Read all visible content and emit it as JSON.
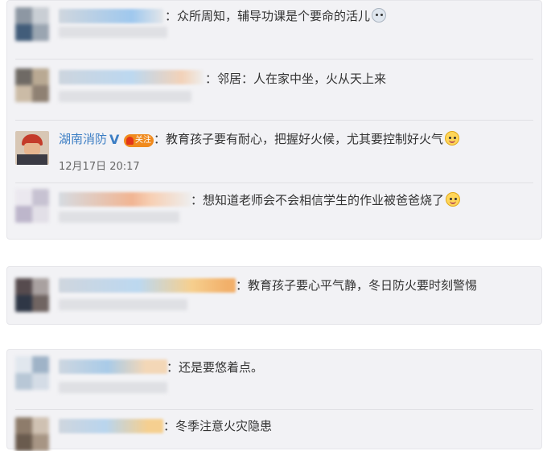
{
  "comments": [
    {
      "text": "：众所周知，辅导功课是个要命的活儿"
    },
    {
      "text": "：邻居：人在家中坐，火从天上来"
    },
    {
      "user": "湖南消防",
      "badge": "关注",
      "text": "：教育孩子要有耐心，把握好火候，尤其要控制好火气",
      "time": "12月17日 20:17"
    },
    {
      "text": "：想知道老师会不会相信学生的作业被爸爸烧了"
    },
    {
      "text": "：教育孩子要心平气静，冬日防火要时刻警惕"
    },
    {
      "text": "：还是要悠着点。"
    },
    {
      "text": "：冬季注意火灾隐患"
    }
  ],
  "colors": {
    "card_bg": "#f2f2f5",
    "link": "#3c7ec4",
    "badge": "#f08a1d"
  },
  "icons": [
    "cry-emoji-icon",
    "verified-v-icon",
    "fan-badge-icon",
    "laugh-cry-emoji-icon",
    "smile-emoji-icon"
  ]
}
